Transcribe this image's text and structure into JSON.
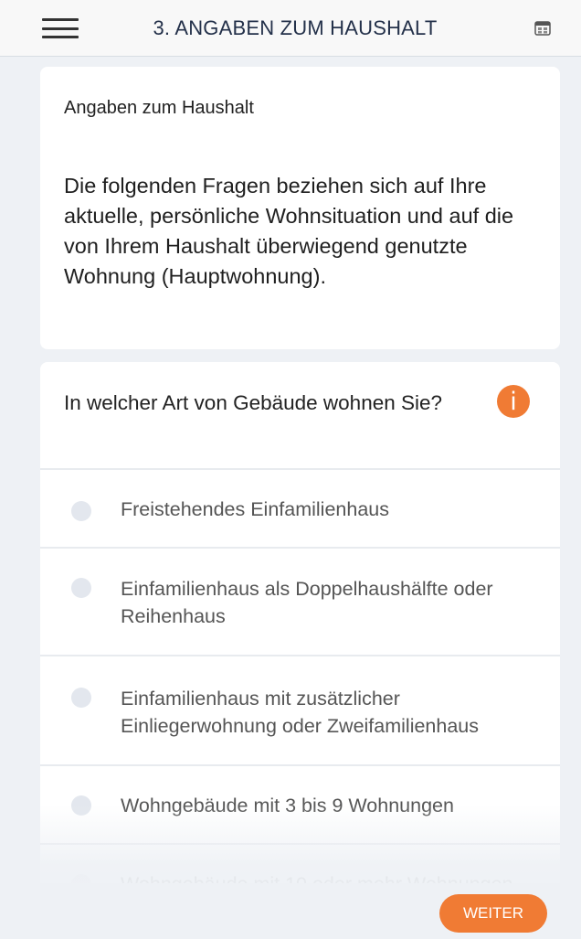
{
  "header": {
    "title": "3. ANGABEN ZUM HAUSHALT",
    "menu_icon": "hamburger-menu-icon",
    "calendar_icon": "calendar-icon"
  },
  "intro": {
    "heading": "Angaben zum Haushalt",
    "text": "Die folgenden Fragen beziehen sich auf Ihre aktuelle, persönliche Wohnsituation und auf die von Ihrem Haushalt überwiegend genutzte Wohnung (Hauptwohnung)."
  },
  "question": {
    "text": "In welcher Art von Gebäude wohnen Sie?",
    "info_icon": "info-icon",
    "info_symbol": "i",
    "options": [
      {
        "label": "Freistehendes Einfamilienhaus"
      },
      {
        "label": "Einfamilienhaus als Doppelhaushälfte oder Reihenhaus"
      },
      {
        "label": "Einfamilienhaus mit zusätzlicher Einliegerwohnung oder Zweifamilienhaus"
      },
      {
        "label": "Wohngebäude mit 3 bis 9 Wohnungen"
      },
      {
        "label": "Wohngebäude mit 10 oder mehr Wohnungen"
      }
    ]
  },
  "footer": {
    "next_label": "WEITER"
  },
  "colors": {
    "accent": "#f07b34",
    "background": "#eef1f5",
    "title": "#24314a"
  }
}
